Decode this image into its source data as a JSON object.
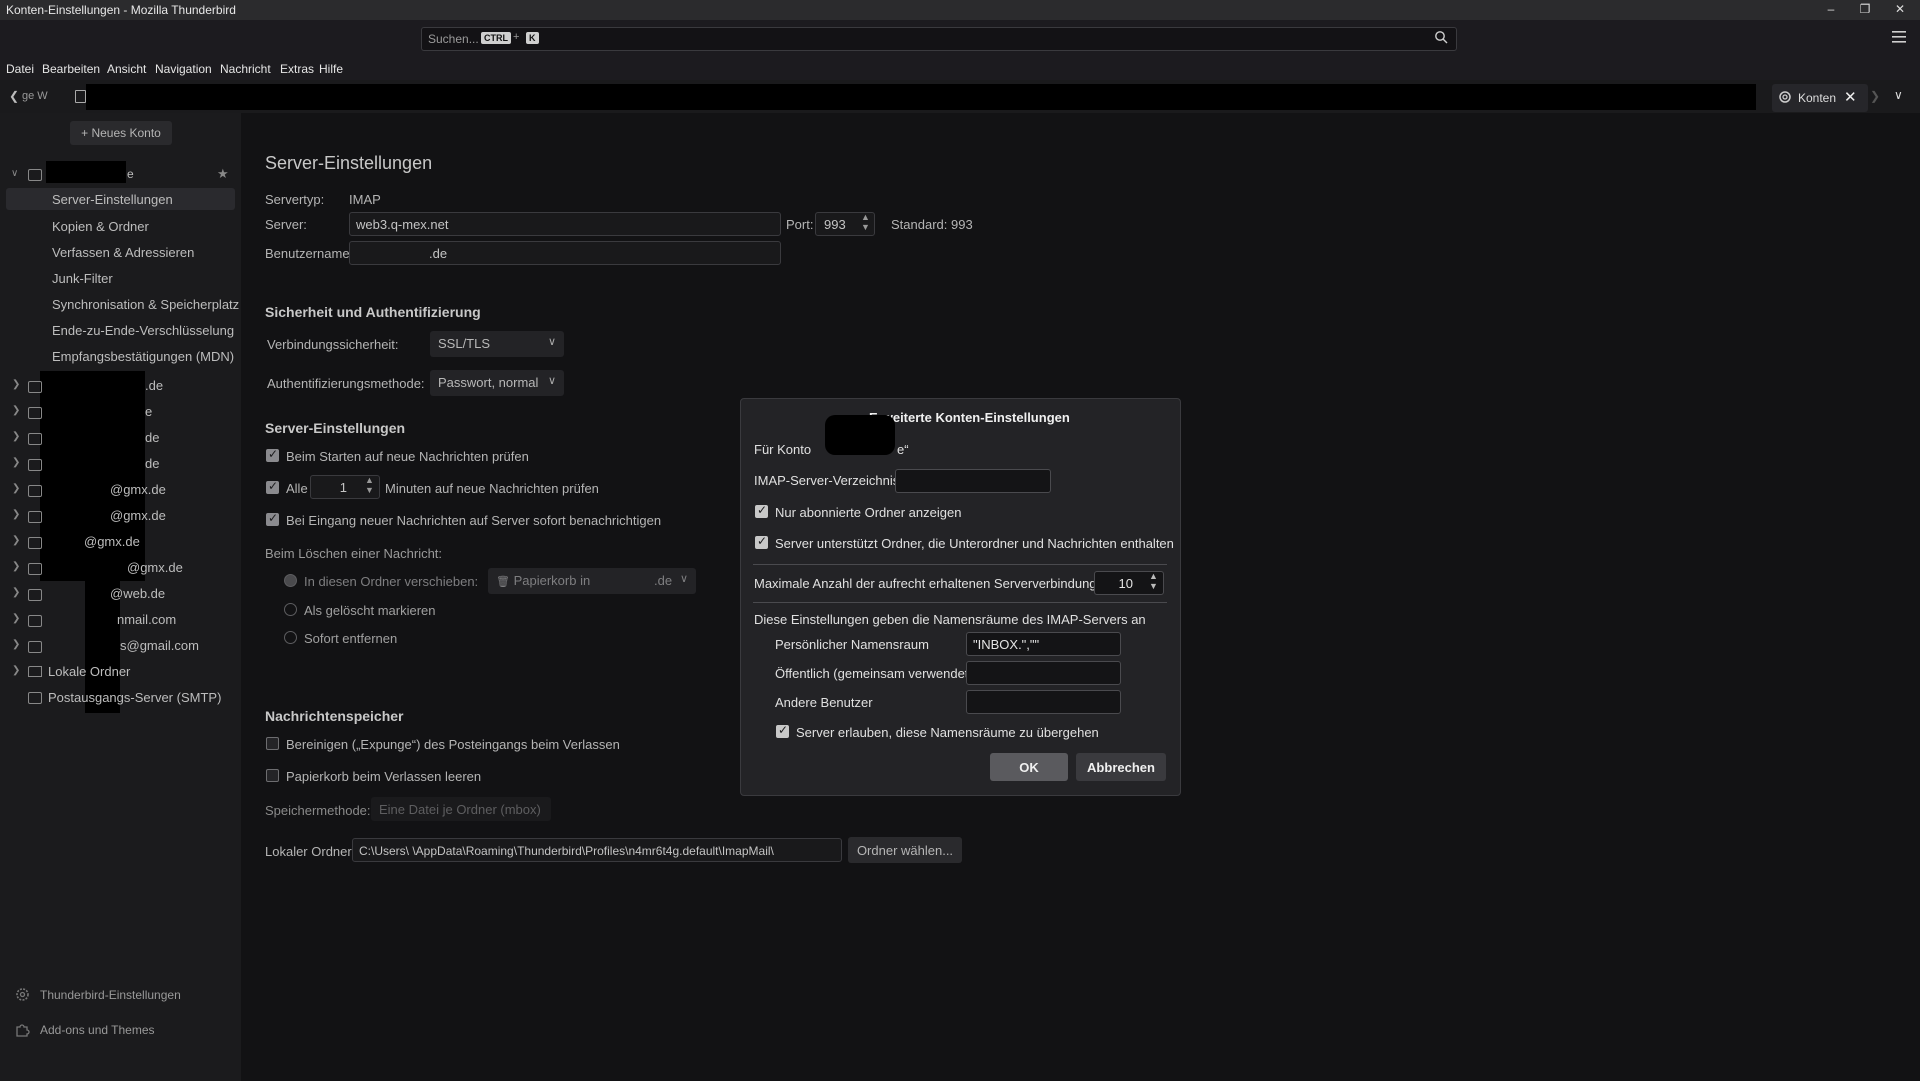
{
  "window": {
    "title": "Konten-Einstellungen - Mozilla Thunderbird",
    "controls": [
      "–",
      "❐",
      "✕"
    ]
  },
  "search": {
    "placeholder": "Suchen...",
    "shortcut_ctrl": "CTRL",
    "shortcut_plus": "+",
    "shortcut_key": "K"
  },
  "menubar": [
    "Datei",
    "Bearbeiten",
    "Ansicht",
    "Navigation",
    "Nachricht",
    "Extras",
    "Hilfe"
  ],
  "tabs": {
    "left_tab_label": "ge W",
    "active_tab_label": "Konten"
  },
  "sidebar": {
    "new_account_button": "+ Neues Konto",
    "account_suffix": "e",
    "subitems": [
      "Server-Einstellungen",
      "Kopien & Ordner",
      "Verfassen & Adressieren",
      "Junk-Filter",
      "Synchronisation & Speicherplatz",
      "Ende-zu-Ende-Verschlüsselung",
      "Empfangsbestätigungen (MDN)"
    ],
    "accounts": [
      ".de",
      "e",
      "de",
      "de",
      "@gmx.de",
      "@gmx.de",
      "@gmx.de",
      "@gmx.de",
      "@web.de",
      "nmail.com",
      "s@gmail.com"
    ],
    "local_folders": "Lokale Ordner",
    "smtp": "Postausgangs-Server (SMTP)",
    "settings": "Thunderbird-Einstellungen",
    "addons": "Add-ons und Themes"
  },
  "main": {
    "heading": "Server-Einstellungen",
    "servertype_label": "Servertyp:",
    "servertype_value": "IMAP",
    "server_label": "Server:",
    "server_value": "web3.q-mex.net",
    "port_label": "Port:",
    "port_value": "993",
    "port_default": "Standard: 993",
    "username_label": "Benutzername:",
    "username_value": ".de",
    "security_heading": "Sicherheit und Authentifizierung",
    "conn_security_label": "Verbindungssicherheit:",
    "conn_security_value": "SSL/TLS",
    "auth_label": "Authentifizierungsmethode:",
    "auth_value": "Passwort, normal",
    "server_settings_heading": "Server-Einstellungen",
    "check_on_start": "Beim Starten auf neue Nachrichten prüfen",
    "check_every_prefix": "Alle",
    "check_every_value": "1",
    "check_every_suffix": "Minuten auf neue Nachrichten prüfen",
    "notify_new": "Bei Eingang neuer Nachrichten auf Server sofort benachrichtigen",
    "on_delete_label": "Beim Löschen einer Nachricht:",
    "move_to_folder": "In diesen Ordner verschieben:",
    "trash_folder": "Papierkorb in",
    "trash_folder_suffix": ".de",
    "mark_deleted": "Als gelöscht markieren",
    "delete_immediately": "Sofort entfernen",
    "storage_heading": "Nachrichtenspeicher",
    "expunge": "Bereinigen („Expunge“) des Posteingangs beim Verlassen",
    "empty_trash": "Papierkorb beim Verlassen leeren",
    "storage_method_label": "Speichermethode:",
    "storage_method_value": "Eine Datei je Ordner (mbox)",
    "local_dir_label": "Lokaler Ordner:",
    "local_dir_value": "C:\\Users\\            \\AppData\\Roaming\\Thunderbird\\Profiles\\n4mr6t4g.default\\ImapMail\\",
    "choose_folder": "Ordner wählen..."
  },
  "dialog": {
    "title": "Erweiterte Konten-Einstellungen",
    "for_account_prefix": "Für Konto",
    "for_account_suffix": "e“",
    "imap_dir_label": "IMAP-Server-Verzeichnis:",
    "imap_dir_value": "",
    "subscribed_only": "Nur abonnierte Ordner anzeigen",
    "server_supports": "Server unterstützt Ordner, die Unterordner und Nachrichten enthalten",
    "max_connections_label": "Maximale Anzahl der aufrecht erhaltenen Serververbindungen",
    "max_connections_value": "10",
    "namespaces_intro": "Diese Einstellungen geben die Namensräume des IMAP-Servers an",
    "personal_ns_label": "Persönlicher Namensraum",
    "personal_ns_value": "\"INBOX.\",\"\"",
    "public_ns_label": "Öffentlich (gemeinsam verwendet)",
    "public_ns_value": "",
    "other_users_label": "Andere Benutzer",
    "other_users_value": "",
    "allow_override": "Server erlauben, diese Namensräume zu übergehen",
    "ok": "OK",
    "cancel": "Abbrechen"
  },
  "colors": {
    "dialog_bg": "#232326",
    "ok_button": "#5a5a5e",
    "cancel_button": "#3a3a3e"
  }
}
